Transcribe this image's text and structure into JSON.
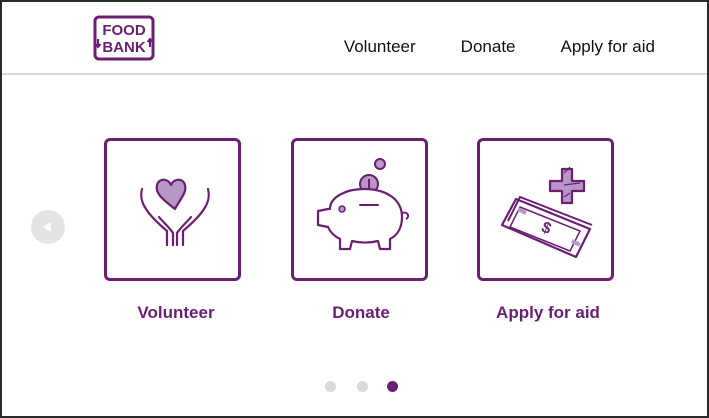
{
  "brand": {
    "logo_line1": "FOOD",
    "logo_line2": "BANK",
    "color": "#6b1f73"
  },
  "nav": [
    {
      "label": "Volunteer"
    },
    {
      "label": "Donate"
    },
    {
      "label": "Apply for aid"
    }
  ],
  "cards": [
    {
      "label": "Volunteer",
      "icon": "hands-heart-icon"
    },
    {
      "label": "Donate",
      "icon": "piggy-bank-icon"
    },
    {
      "label": "Apply for aid",
      "icon": "money-plus-icon"
    }
  ],
  "carousel": {
    "total": 3,
    "active_index": 2
  },
  "colors": {
    "accent": "#6b1f73",
    "accent_light": "#b896c6",
    "dot_inactive": "#d9d9d9",
    "divider": "#d7d7d7"
  }
}
